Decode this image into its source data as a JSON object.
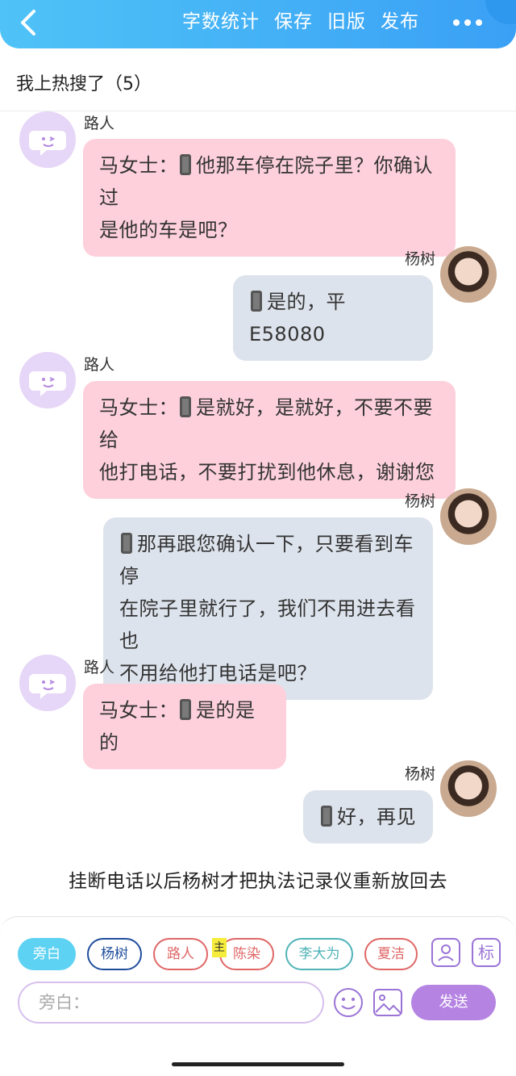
{
  "header": {
    "actions": [
      "字数统计",
      "保存",
      "旧版",
      "发布"
    ]
  },
  "page_title": "我上热搜了（5）",
  "messages": [
    {
      "side": "left",
      "name": "路人",
      "text": "马女士：",
      "text2": "他那车停在院子里？你确认过",
      "text3": "是他的车是吧？"
    },
    {
      "side": "right",
      "name": "杨树",
      "text": "是的，平E58080"
    },
    {
      "side": "left",
      "name": "路人",
      "text": "马女士：",
      "text2": "是就好，是就好，不要不要给",
      "text3": "他打电话，不要打扰到他休息，谢谢您"
    },
    {
      "side": "right",
      "name": "杨树",
      "text": "那再跟您确认一下，只要看到车停",
      "text2": "在院子里就行了，我们不用进去看也",
      "text3": "不用给他打电话是吧？"
    },
    {
      "side": "left",
      "name": "路人",
      "text": "马女士：",
      "text2": "是的是的"
    },
    {
      "side": "right",
      "name": "杨树",
      "text": "好，再见"
    }
  ],
  "narration": "挂断电话以后杨树才把执法记录仪重新放回去",
  "roles": [
    {
      "label": "旁白",
      "color": "#5ed2f2"
    },
    {
      "label": "杨树",
      "color": "#1f4e9c"
    },
    {
      "label": "路人",
      "color": "#e06666"
    },
    {
      "label": "陈染",
      "color": "#e06666"
    },
    {
      "label": "李大为",
      "color": "#4fb3b8"
    },
    {
      "label": "夏洁",
      "color": "#e06666"
    }
  ],
  "main_badge": "主",
  "tools": {
    "user_icon": "user-card-icon",
    "tag_label": "标"
  },
  "input": {
    "placeholder": "旁白："
  },
  "send_label": "发送"
}
